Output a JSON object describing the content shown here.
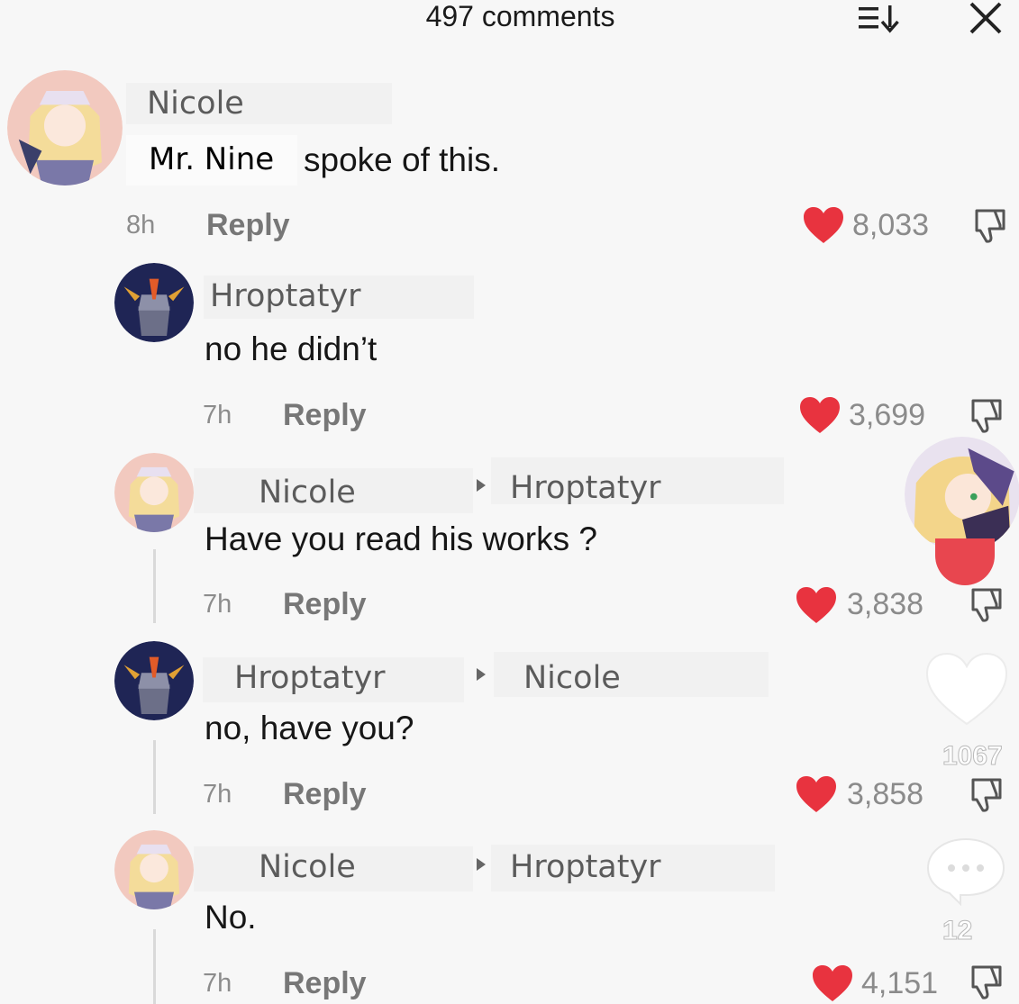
{
  "header": {
    "title": "497 comments"
  },
  "comments": [
    {
      "user": "Nicole",
      "text_after_mention": "spoke of this.",
      "mention": "Mr. Nine",
      "time": "8h",
      "reply_label": "Reply",
      "likes": "8,033"
    },
    {
      "user": "Hroptatyr",
      "text": "no he didn’t",
      "time": "7h",
      "reply_label": "Reply",
      "likes": "3,699"
    },
    {
      "user": "Nicole",
      "reply_to": "Hroptatyr",
      "text": "Have you read his works ?",
      "time": "7h",
      "reply_label": "Reply",
      "likes": "3,838"
    },
    {
      "user": "Hroptatyr",
      "reply_to": "Nicole",
      "text": "no, have you?",
      "time": "7h",
      "reply_label": "Reply",
      "likes": "3,858"
    },
    {
      "user": "Nicole",
      "reply_to": "Hroptatyr",
      "text": "No.",
      "time": "7h",
      "reply_label": "Reply",
      "likes": "4,151"
    }
  ],
  "side_panel": {
    "like_count": "1067",
    "comment_count": "12"
  },
  "colors": {
    "heart": "#e8333f",
    "background": "#f7f7f7"
  },
  "icons": [
    "sort-icon",
    "close-icon",
    "heart-icon",
    "dislike-icon",
    "comment-bubble-icon"
  ]
}
